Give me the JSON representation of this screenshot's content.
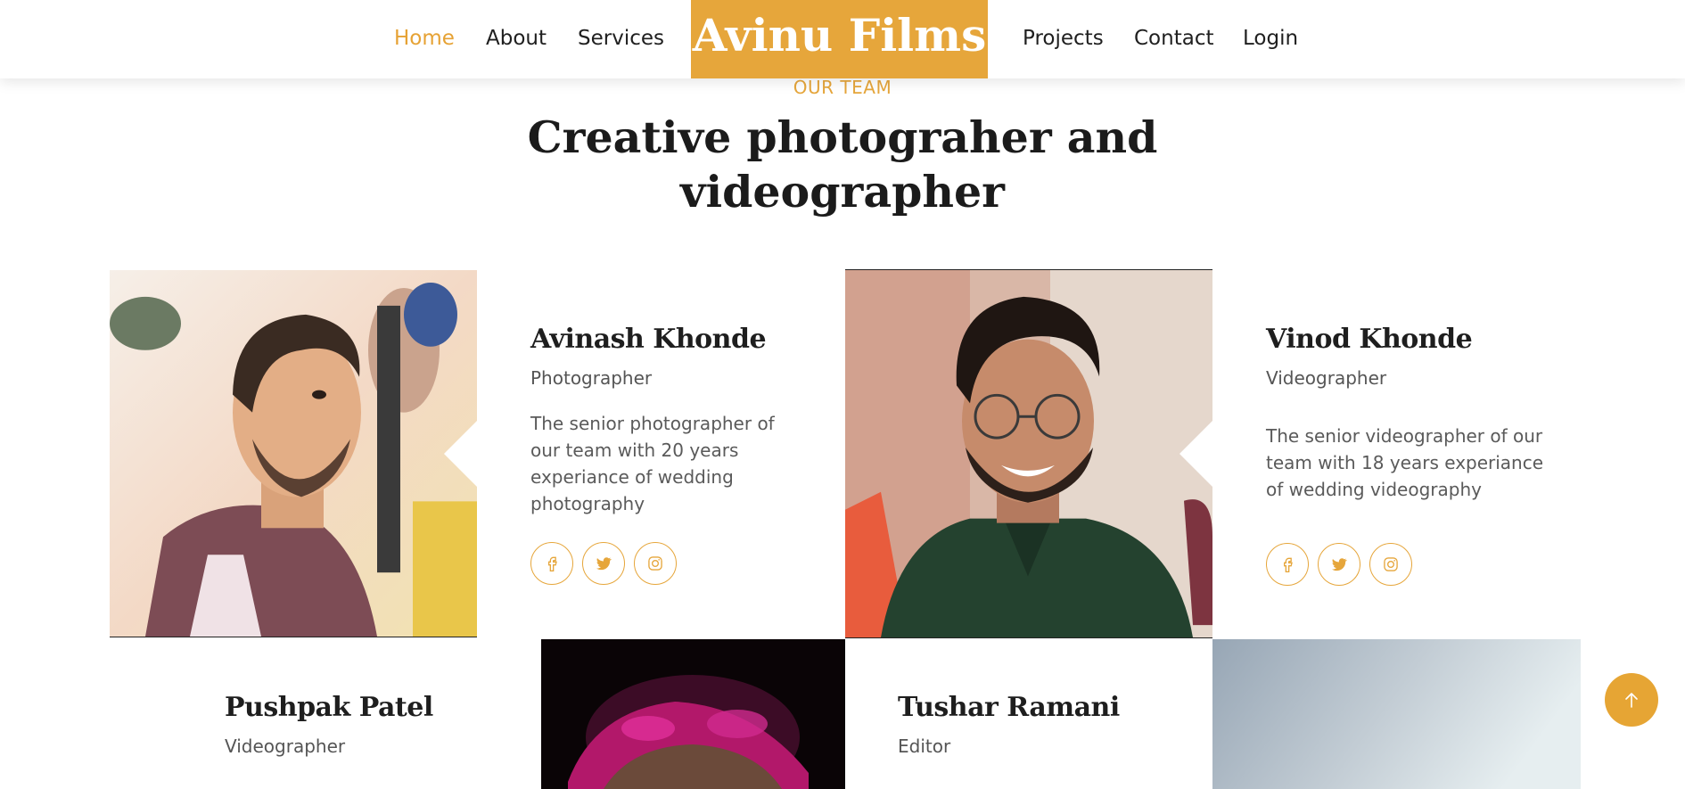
{
  "nav": {
    "brand": "Avinu Films",
    "links_left": [
      {
        "label": "Home",
        "active": true
      },
      {
        "label": "About",
        "active": false
      },
      {
        "label": "Services",
        "active": false
      }
    ],
    "links_right": [
      {
        "label": "Projects",
        "active": false
      },
      {
        "label": "Contact",
        "active": false
      },
      {
        "label": "Login",
        "active": false
      }
    ]
  },
  "section": {
    "eyebrow": "OUR TEAM",
    "title_line1": "Creative photograher and",
    "title_line2": "videographer"
  },
  "team": [
    {
      "name": "Avinash Khonde",
      "role": "Photographer",
      "bio": [
        "The senior photographer of",
        "our team with 20 years",
        "experiance of wedding",
        "photography"
      ],
      "socials": [
        "facebook-icon",
        "twitter-icon",
        "instagram-icon"
      ]
    },
    {
      "name": "Vinod Khonde",
      "role": "Videographer",
      "bio": [
        "The senior videographer of our",
        "team with 18 years experiance",
        "of wedding videography"
      ],
      "socials": [
        "facebook-icon",
        "twitter-icon",
        "instagram-icon"
      ]
    },
    {
      "name": "Pushpak Patel",
      "role": "Videographer"
    },
    {
      "name": "Tushar Ramani",
      "role": "Editor"
    }
  ],
  "colors": {
    "accent": "#e6a63b",
    "text_dark": "#1e1e1e",
    "text_muted": "#555555"
  },
  "icons": {
    "scroll_top": "arrow-up-icon"
  }
}
